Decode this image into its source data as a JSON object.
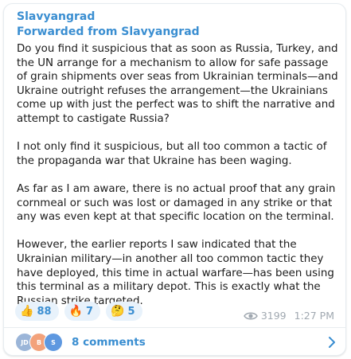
{
  "post": {
    "channel_name": "Slavyangrad",
    "forwarded_from": "Forwarded from Slavyangrad",
    "paragraphs": [
      "Do you find it suspicious that as soon as Russia, Turkey, and the UN arrange for a mechanism to allow for safe passage of grain shipments over seas from Ukrainian terminals—and Ukraine outright refuses the arrangement—the Ukrainians come up with just the perfect was to shift the narrative and attempt to castigate Russia?",
      "I not only find it suspicious, but all too common a tactic of the propaganda war that Ukraine has been waging.",
      "As far as I am aware, there is no actual proof that any grain cornmeal or such was lost or damaged in any strike or that any was even kept at that specific location on the terminal.",
      "However, the earlier reports I saw indicated that the Ukrainian military—in another all too common tactic they have deployed, this time in actual warfare—has been using this terminal as a military depot. This is exactly what the Russian strike targeted."
    ],
    "views": "3199",
    "time": "1:27 PM"
  },
  "reactions": [
    {
      "emoji": "👍",
      "icon": "thumbs-up-icon",
      "count": "88"
    },
    {
      "emoji": "🔥",
      "icon": "fire-icon",
      "count": "7"
    },
    {
      "emoji": "🤔",
      "icon": "thinking-face-icon",
      "count": "5"
    }
  ],
  "comments": {
    "label": "8 comments",
    "avatars": [
      {
        "initials": "JD",
        "color": "#9bb5d8"
      },
      {
        "initials": "B",
        "color": "#f3a27b"
      },
      {
        "initials": "S",
        "color": "#5e98e0"
      }
    ]
  },
  "colors": {
    "accent": "#3a8ed1",
    "reaction_bg": "#e8f2fb",
    "meta_gray": "#a0a8b0"
  }
}
